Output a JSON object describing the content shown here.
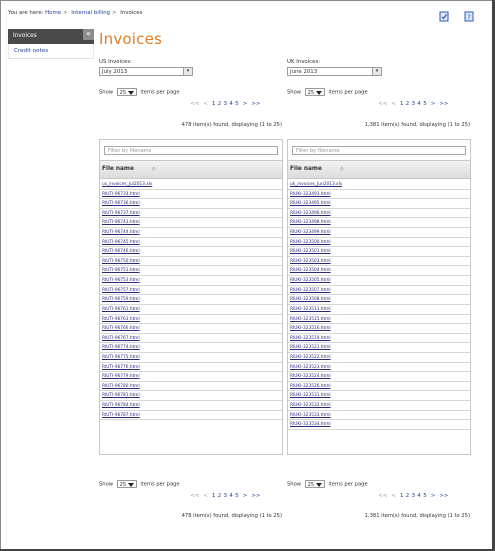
{
  "breadcrumb": {
    "prefix": "You are here:",
    "items": [
      "Home",
      "Internal billing",
      "Invoices"
    ]
  },
  "sidebar": {
    "items": [
      {
        "label": "Invoices",
        "active": true
      },
      {
        "label": "Credit notes",
        "active": false
      }
    ],
    "collapse_symbol": "«"
  },
  "page_title": "Invoices",
  "icons": {
    "top_left": "document-check-icon",
    "top_right": "help-icon"
  },
  "pager": {
    "first": "<<",
    "prev": "<",
    "pages": [
      "1",
      "2",
      "3",
      "4",
      "5"
    ],
    "next": ">",
    "last": ">>"
  },
  "us": {
    "label": "US Invoices:",
    "selected": "July 2013",
    "show_prefix": "Show",
    "page_size": "25",
    "show_suffix": "items per page",
    "status": "478 item(s) found, displaying (1 to 25)",
    "filter_placeholder": "Filter by filename",
    "col_header": "File name",
    "sort_symbol": "◇",
    "rows": [
      "us_invoices_Jul2013.xls",
      "RIUTI-96733.html",
      "RIUTI-96736.html",
      "RIUTI-96737.html",
      "RIUTI-96743.html",
      "RIUTI-96744.html",
      "RIUTI-96745.html",
      "RIUTI-96746.html",
      "RIUTI-96750.html",
      "RIUTI-96751.html",
      "RIUTI-96753.html",
      "RIUTI-96757.html",
      "RIUTI-96759.html",
      "RIUTI-96761.html",
      "RIUTI-96763.html",
      "RIUTI-96766.html",
      "RIUTI-96767.html",
      "RIUTI-96774.html",
      "RIUTI-96775.html",
      "RIUTI-96776.html",
      "RIUTI-96779.html",
      "RIUTI-96780.html",
      "RIUTI-96781.html",
      "RIUTI-96784.html",
      "RIUTI-96787.html"
    ]
  },
  "uk": {
    "label": "UK Invoices:",
    "selected": "June 2013",
    "show_prefix": "Show",
    "page_size": "25",
    "show_suffix": "items per page",
    "status": "1,381 item(s) found, displaying (1 to 25)",
    "filter_placeholder": "Filter by filename",
    "col_header": "File name",
    "sort_symbol": "◇",
    "rows": [
      "uk_invoices_Jun2013.xls",
      "RIUKI-323493.html",
      "RIUKI-323495.html",
      "RIUKI-323496.html",
      "RIUKI-323498.html",
      "RIUKI-323499.html",
      "RIUKI-323500.html",
      "RIUKI-323501.html",
      "RIUKI-323503.html",
      "RIUKI-323504.html",
      "RIUKI-323505.html",
      "RIUKI-323507.html",
      "RIUKI-323508.html",
      "RIUKI-323513.html",
      "RIUKI-323515.html",
      "RIUKI-323516.html",
      "RIUKI-323519.html",
      "RIUKI-323521.html",
      "RIUKI-323522.html",
      "RIUKI-323523.html",
      "RIUKI-323524.html",
      "RIUKI-323526.html",
      "RIUKI-323531.html",
      "RIUKI-323532.html",
      "RIUKI-323533.html",
      "RIUKI-323534.html"
    ]
  }
}
